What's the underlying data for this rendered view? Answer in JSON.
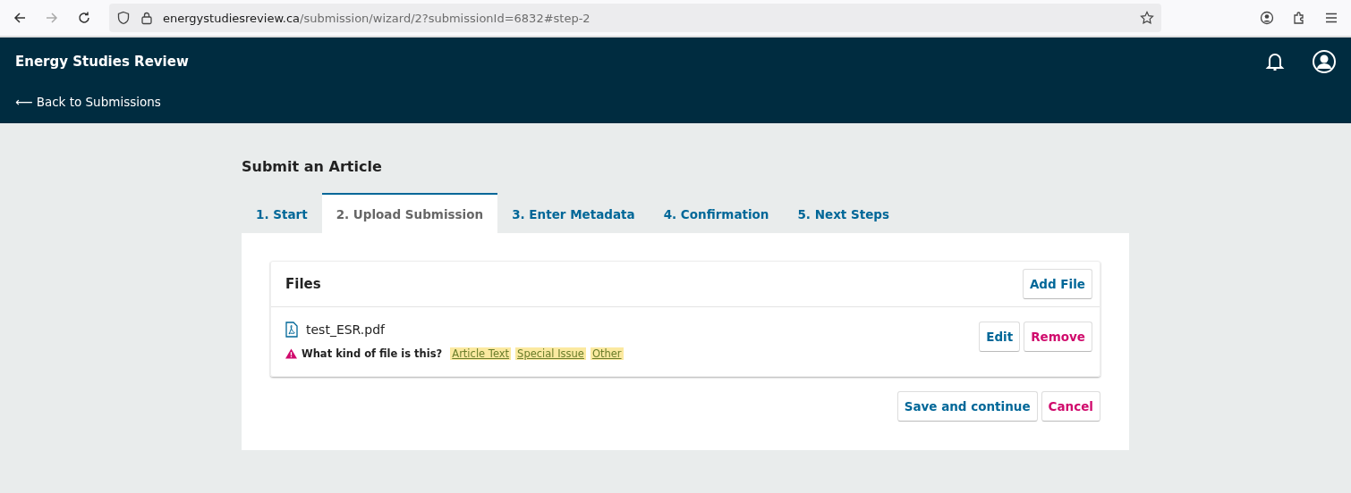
{
  "browser": {
    "url_domain": "energystudiesreview.ca",
    "url_path": "/submission/wizard/2?submissionId=6832#step-2"
  },
  "header": {
    "site_title": "Energy Studies Review",
    "back_link": "⟵ Back to Submissions"
  },
  "page_title": "Submit an Article",
  "tabs": [
    {
      "label": "1. Start",
      "selected": false
    },
    {
      "label": "2. Upload Submission",
      "selected": true
    },
    {
      "label": "3. Enter Metadata",
      "selected": false
    },
    {
      "label": "4. Confirmation",
      "selected": false
    },
    {
      "label": "5. Next Steps",
      "selected": false
    }
  ],
  "files_panel": {
    "title": "Files",
    "add_button": "Add File",
    "files": [
      {
        "name": "test_ESR.pdf",
        "question": "What kind of file is this?",
        "options": [
          {
            "label": "Article Text",
            "highlighted": true
          },
          {
            "label": "Special Issue",
            "highlighted": true
          },
          {
            "label": "Other",
            "highlighted": true
          }
        ],
        "buttons": [
          {
            "label": "Edit",
            "kind": "primary"
          },
          {
            "label": "Remove",
            "kind": "danger"
          }
        ]
      }
    ]
  },
  "actions": [
    {
      "label": "Save and continue",
      "kind": "primary"
    },
    {
      "label": "Cancel",
      "kind": "danger"
    }
  ]
}
